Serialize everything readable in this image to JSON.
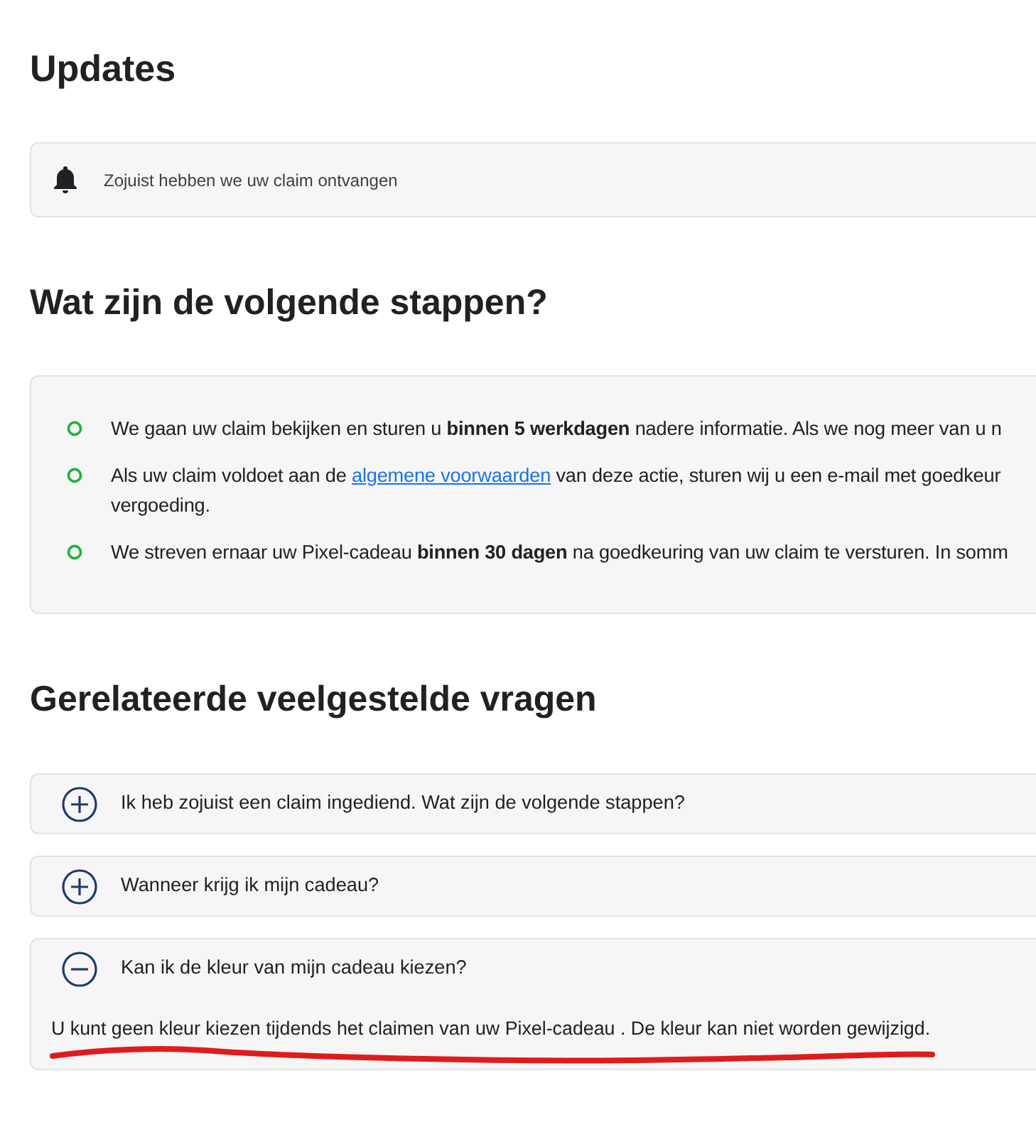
{
  "updates": {
    "title": "Updates",
    "notice": "Zojuist hebben we uw claim ontvangen"
  },
  "next_steps": {
    "title": "Wat zijn de volgende stappen?",
    "items": [
      {
        "parts": [
          {
            "kind": "text",
            "text": "We gaan uw claim bekijken en sturen u **binnen 5 werkdagen** nadere informatie. Als we nog meer van u n"
          }
        ]
      },
      {
        "parts": [
          {
            "kind": "text",
            "text": "Als uw claim voldoet aan de "
          },
          {
            "kind": "link",
            "text": "algemene voorwaarden"
          },
          {
            "kind": "text",
            "text": " van deze actie, sturen wij u een e-mail met goedkeur"
          },
          {
            "kind": "break"
          },
          {
            "kind": "text",
            "text": "vergoeding."
          }
        ]
      },
      {
        "parts": [
          {
            "kind": "text",
            "text": "We streven ernaar uw Pixel-cadeau **binnen 30 dagen** na goedkeuring van uw claim te versturen. In somm"
          }
        ]
      }
    ]
  },
  "faq": {
    "title": "Gerelateerde veelgestelde vragen",
    "items": [
      {
        "question": "Ik heb zojuist een claim ingediend. Wat zijn de volgende stappen?",
        "expanded": false
      },
      {
        "question": "Wanneer krijg ik mijn cadeau?",
        "expanded": false
      },
      {
        "question": "Kan ik de kleur van mijn cadeau kiezen?",
        "expanded": true,
        "answer": "U kunt geen kleur kiezen tijdends het claimen van uw Pixel-cadeau . De kleur kan niet worden gewijzigd."
      }
    ]
  }
}
